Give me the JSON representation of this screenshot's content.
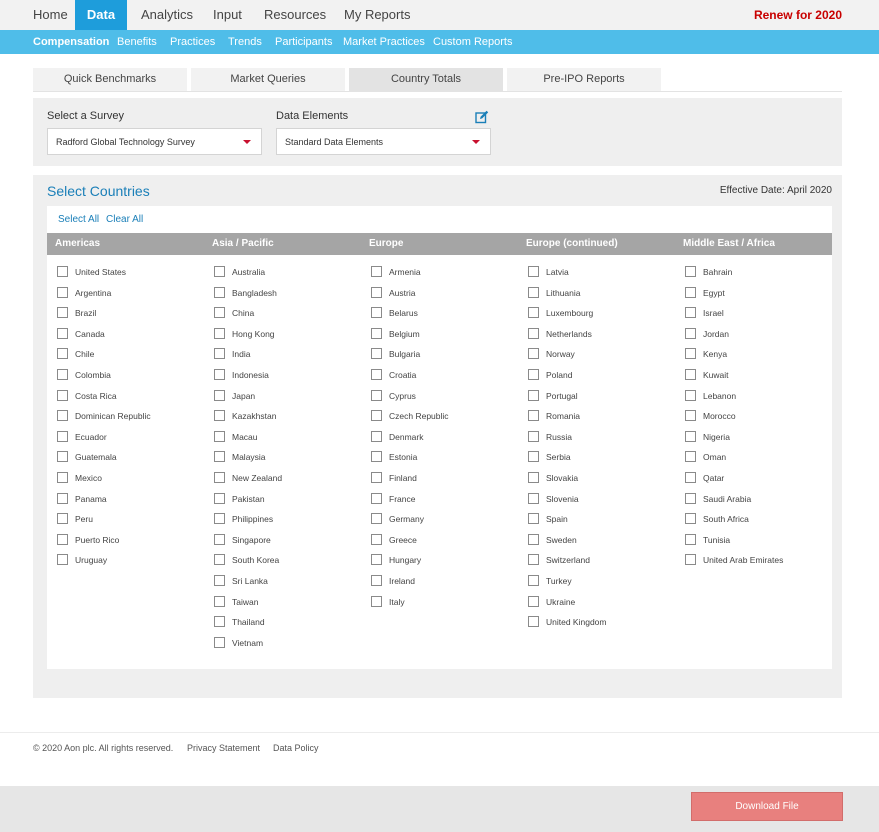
{
  "top_nav": {
    "items": [
      {
        "label": "Home",
        "active": false
      },
      {
        "label": "Data",
        "active": true
      },
      {
        "label": "Analytics",
        "active": false
      },
      {
        "label": "Input",
        "active": false
      },
      {
        "label": "Resources",
        "active": false
      },
      {
        "label": "My Reports",
        "active": false
      }
    ],
    "renew_label": "Renew for 2020"
  },
  "sub_nav": {
    "items": [
      {
        "label": "Compensation",
        "active": true
      },
      {
        "label": "Benefits",
        "active": false
      },
      {
        "label": "Practices",
        "active": false
      },
      {
        "label": "Trends",
        "active": false
      },
      {
        "label": "Participants",
        "active": false
      },
      {
        "label": "Market Practices",
        "active": false
      },
      {
        "label": "Custom Reports",
        "active": false
      }
    ]
  },
  "tabs": [
    {
      "label": "Quick Benchmarks",
      "active": false
    },
    {
      "label": "Market Queries",
      "active": false
    },
    {
      "label": "Country Totals",
      "active": true
    },
    {
      "label": "Pre-IPO Reports",
      "active": false
    }
  ],
  "survey": {
    "label": "Select a Survey",
    "value": "Radford Global Technology Survey",
    "data_elements_label": "Data Elements",
    "data_elements_value": "Standard Data Elements",
    "edit_icon": "edit-icon"
  },
  "countries": {
    "title": "Select Countries",
    "effective_date": "Effective Date: April 2020",
    "select_all": "Select All",
    "clear_all": "Clear All",
    "columns": [
      {
        "heading": "Americas",
        "items": [
          "United States",
          "Argentina",
          "Brazil",
          "Canada",
          "Chile",
          "Colombia",
          "Costa Rica",
          "Dominican Republic",
          "Ecuador",
          "Guatemala",
          "Mexico",
          "Panama",
          "Peru",
          "Puerto Rico",
          "Uruguay"
        ]
      },
      {
        "heading": "Asia / Pacific",
        "items": [
          "Australia",
          "Bangladesh",
          "China",
          "Hong Kong",
          "India",
          "Indonesia",
          "Japan",
          "Kazakhstan",
          "Macau",
          "Malaysia",
          "New Zealand",
          "Pakistan",
          "Philippines",
          "Singapore",
          "South Korea",
          "Sri Lanka",
          "Taiwan",
          "Thailand",
          "Vietnam"
        ]
      },
      {
        "heading": "Europe",
        "items": [
          "Armenia",
          "Austria",
          "Belarus",
          "Belgium",
          "Bulgaria",
          "Croatia",
          "Cyprus",
          "Czech Republic",
          "Denmark",
          "Estonia",
          "Finland",
          "France",
          "Germany",
          "Greece",
          "Hungary",
          "Ireland",
          "Italy"
        ]
      },
      {
        "heading": "Europe (continued)",
        "items": [
          "Latvia",
          "Lithuania",
          "Luxembourg",
          "Netherlands",
          "Norway",
          "Poland",
          "Portugal",
          "Romania",
          "Russia",
          "Serbia",
          "Slovakia",
          "Slovenia",
          "Spain",
          "Sweden",
          "Switzerland",
          "Turkey",
          "Ukraine",
          "United Kingdom"
        ]
      },
      {
        "heading": "Middle East / Africa",
        "items": [
          "Bahrain",
          "Egypt",
          "Israel",
          "Jordan",
          "Kenya",
          "Kuwait",
          "Lebanon",
          "Morocco",
          "Nigeria",
          "Oman",
          "Qatar",
          "Saudi Arabia",
          "South Africa",
          "Tunisia",
          "United Arab Emirates"
        ]
      }
    ]
  },
  "footer": {
    "copyright": "© 2020 Aon plc. All rights reserved.",
    "privacy": "Privacy Statement",
    "data_policy": "Data Policy"
  },
  "download_button": "Download File",
  "colors": {
    "primary_blue": "#1e9ddb",
    "sub_nav_blue": "#4fbde9",
    "renew_red": "#c80000",
    "download_red": "#e8807e"
  }
}
